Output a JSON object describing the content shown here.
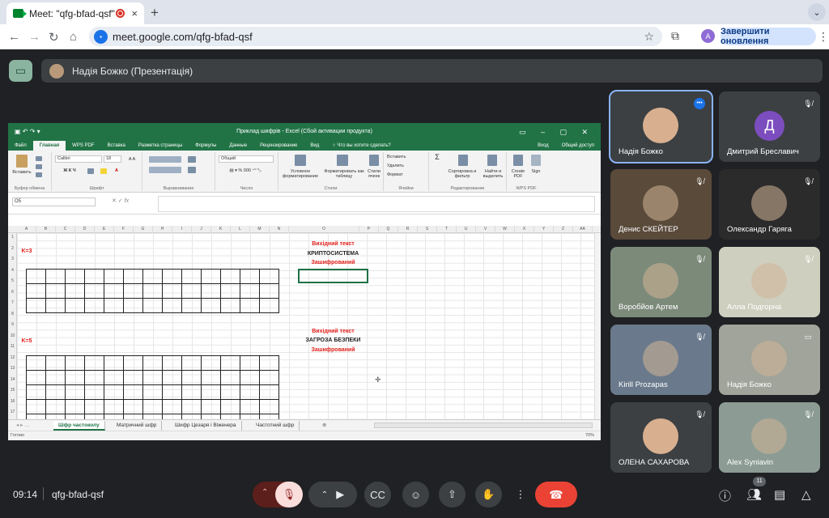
{
  "browser": {
    "tab_title": "Meet: \"qfg-bfad-qsf\"",
    "tab_close": "×",
    "new_tab": "+",
    "tab_menu": "⌄",
    "url": "meet.google.com/qfg-bfad-qsf",
    "profile_initial": "A",
    "update_button": "Завершити оновлення",
    "menu": "⋮"
  },
  "meet": {
    "presenter": "Надія Божко (Презентація)",
    "time": "09:14",
    "code": "qfg-bfad-qsf",
    "participants_count": "11"
  },
  "excel": {
    "title": "Приклад шифрів - Excel (Сбой активации продукта)",
    "menu": [
      "Файл",
      "Главная",
      "WPS PDF",
      "Вставка",
      "Разметка страницы",
      "Формулы",
      "Данные",
      "Рецензирование",
      "Вид",
      "♀ Что вы хотите сделать?"
    ],
    "menu_right": [
      "Вход",
      "Общий доступ"
    ],
    "ribbon": {
      "paste": "Вставить",
      "clipboard": "Буфер обмена",
      "font_name": "Calibri",
      "font_size": "18",
      "font": "Шрифт",
      "alignment": "Выравнивание",
      "number_format": "Общий",
      "number": "Число",
      "cond_format": "Условное форматирование",
      "format_table": "Форматировать как таблицу",
      "cell_styles": "Стили ячеек",
      "styles": "Стили",
      "insert": "Вставить",
      "delete": "Удалить",
      "format": "Формат",
      "cells": "Ячейки",
      "sort": "Сортировка и фильтр",
      "find": "Найти и выделить",
      "editing": "Редактирование",
      "create_pdf": "Create PDF",
      "sign": "Sign",
      "wps_pdf": "WPS PDF"
    },
    "name_box": "O5",
    "fx": "fx",
    "columns": [
      "A",
      "B",
      "C",
      "D",
      "E",
      "F",
      "G",
      "H",
      "I",
      "J",
      "K",
      "L",
      "M",
      "N",
      "O",
      "P",
      "Q",
      "R",
      "S",
      "T",
      "U",
      "V",
      "W",
      "X",
      "Y",
      "Z",
      "AA"
    ],
    "rows": [
      "1",
      "2",
      "3",
      "4",
      "5",
      "6",
      "7",
      "8",
      "9",
      "10",
      "11",
      "12",
      "13",
      "14",
      "15",
      "16",
      "17"
    ],
    "cells": {
      "k3": "K=3",
      "k5": "K=5",
      "src1": "Вихідний текст",
      "crypto": "КРИПТОСИСТЕМА",
      "enc1": "Зашифрований",
      "src2": "Вихідний текст",
      "threat": "ЗАГРОЗА БЕЗПЕКИ",
      "enc2": "Зашифрований"
    },
    "sheets": [
      "Шфр частоколу",
      "Матричний шфр",
      "Шифр Цезаря і Віженера",
      "Частотний шфр"
    ],
    "status": "Готово",
    "zoom": "70%"
  },
  "participants": [
    {
      "name": "Надія Божко",
      "highlight": true
    },
    {
      "name": "Дмитрий Бреславич",
      "initial": "Д",
      "color": "#7c4dbf"
    },
    {
      "name": "Денис СКЕЙТЕР"
    },
    {
      "name": "Олександр Гаряга"
    },
    {
      "name": "Воробйов Артем"
    },
    {
      "name": "Алла Подгорна"
    },
    {
      "name": "Kirill Prozapas"
    },
    {
      "name": "Надія Божко"
    },
    {
      "name": "ОЛЕНА САХАРОВА"
    },
    {
      "name": "Alex Syniavin"
    }
  ]
}
